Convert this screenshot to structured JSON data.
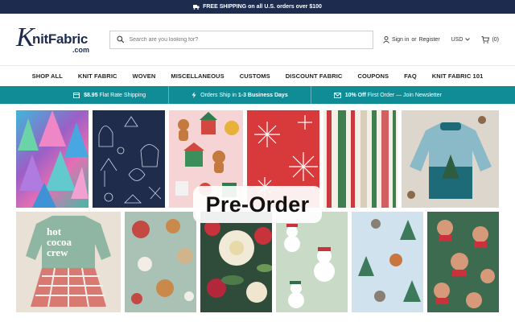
{
  "topbar": {
    "icon": "truck-icon",
    "text": "FREE SHIPPING on all U.S. orders over $100"
  },
  "header": {
    "logo": {
      "k": "K",
      "name": "nitFabric",
      "suffix": ".com"
    },
    "search_placeholder": "Search are you looking for?",
    "sign_in": "Sign in",
    "or": "or",
    "register": "Register",
    "currency": "USD",
    "cart_count": "(0)"
  },
  "nav": [
    "SHOP ALL",
    "KNIT FABRIC",
    "WOVEN",
    "MISCELLANEOUS",
    "CUSTOMS",
    "DISCOUNT FABRIC",
    "COUPONS",
    "FAQ",
    "KNIT FABRIC 101"
  ],
  "promo": [
    {
      "icon": "box-icon",
      "prefix": "",
      "bold": "$8.95",
      "rest": " Flat Rate Shipping"
    },
    {
      "icon": "bolt-icon",
      "prefix": "Orders Ship in ",
      "bold": "1-3 Business Days",
      "rest": ""
    },
    {
      "icon": "mail-icon",
      "prefix": "",
      "bold": "10% Off",
      "rest": " First Order — Join Newsletter"
    }
  ],
  "overlay": "Pre-Order",
  "tile_text": {
    "line1": "hot",
    "line2": "cocoa",
    "line3": "crew"
  },
  "colors": {
    "navy": "#1d2b4f",
    "teal": "#108c96"
  }
}
